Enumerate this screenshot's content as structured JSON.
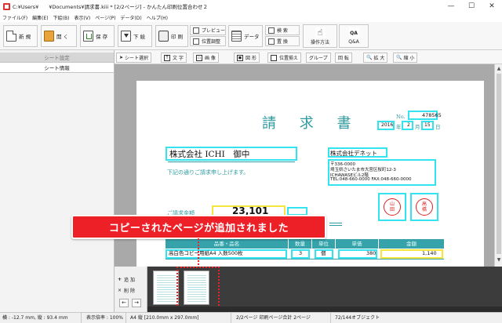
{
  "window": {
    "title": "C:¥Users¥　　¥Documents¥請求書.kiii * [2/2ページ] - かんたん印刷位置合わせ２",
    "controls": [
      "—",
      "☐",
      "✕"
    ]
  },
  "menu": [
    "ファイル(F)",
    "編集(E)",
    "下絵(B)",
    "表示(V)",
    "ページ(P)",
    "データ(D)",
    "ヘルプ(H)"
  ],
  "toolbar": {
    "new": "新 規",
    "open": "開 く",
    "save": "保 存",
    "download": "下 絵",
    "print": "印 刷",
    "preview": "プレビュー",
    "position_adjust": "位置調整",
    "data": "データ",
    "search": "検 索",
    "replace": "置 換",
    "howto": "操作方法",
    "qa": "Q&A",
    "qa_icon": "QA"
  },
  "left_panel": {
    "tab_sheet_settings": "シート設定",
    "tab_sheet_info": "シート情報"
  },
  "object_toolbar": [
    "シート選択",
    "文 字",
    "画 像",
    "図 形",
    "位置揃え",
    "グループ",
    "回 転",
    "拡 大",
    "縮 小"
  ],
  "object_toolbar_icons": [
    "T",
    "▭",
    "◼"
  ],
  "invoice": {
    "title": "請 求 書",
    "no_label": "No.",
    "no_value": "478565",
    "year": "2016",
    "year_suffix": "年",
    "month": "2",
    "month_suffix": "月",
    "day": "15",
    "day_suffix": "日",
    "customer": "株式会社 ICHI　御中",
    "request_text": "下記の通りご請求申し上げます。",
    "issuer": "株式会社デネット",
    "address_lines": [
      "〒336-0000",
      "埼玉県さいたま市大宮区桜町12-3",
      "ICHAWASEビル2階",
      "TEL:048-660-0000  FAX:048-660-0000"
    ],
    "stamp1": [
      "山",
      "田"
    ],
    "stamp2": [
      "高",
      "橋"
    ],
    "amount_label": "ご請求金額",
    "amount_value": "23,101",
    "table_headers": [
      "品番・品名",
      "数量",
      "単位",
      "単価",
      "金額"
    ],
    "row": {
      "name": "高白色コピー用紙A4 入数500枚",
      "qty": "3",
      "unit": "個",
      "price": "380",
      "amount": "1,140"
    }
  },
  "toast": "コピーされたページが追加されました",
  "page_panel": {
    "add": "追 加",
    "delete": "削 除",
    "prev": "←",
    "next": "→"
  },
  "status": {
    "coords": "横 : -12.7 mm, 縦 : 93.4 mm",
    "zoom": "表示倍率 : 100%",
    "paper": "A4 縦 [210.0mm x 297.0mm]",
    "pages": "2/2ページ 印刷ページ合計 2ページ",
    "objects": "72/144オブジェクト"
  }
}
